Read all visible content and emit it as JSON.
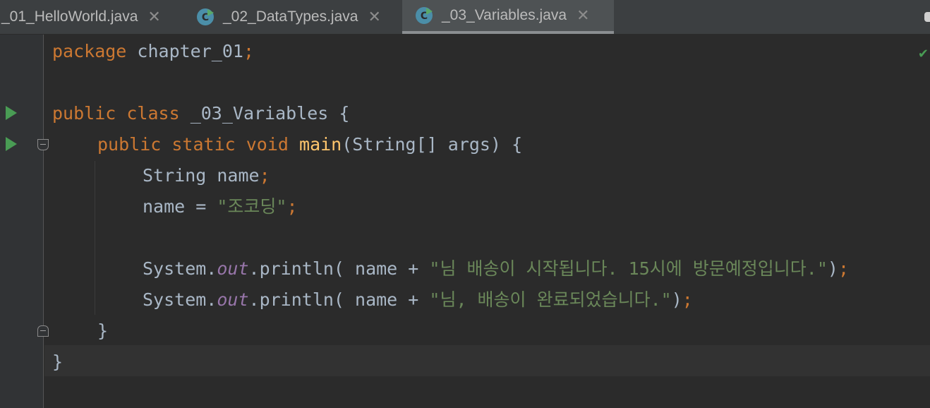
{
  "tabs": [
    {
      "label": "_01_HelloWorld.java",
      "close": "✕",
      "icon": "java-class-icon"
    },
    {
      "label": "_02_DataTypes.java",
      "close": "✕",
      "icon": "java-class-icon"
    },
    {
      "label": "_03_Variables.java",
      "close": "✕",
      "icon": "java-class-icon",
      "active": true
    }
  ],
  "colors": {
    "keyword": "#cc7832",
    "string": "#6a8759",
    "function": "#ffc66d",
    "field": "#9876aa",
    "text": "#a9b7c6",
    "background": "#2b2b2b"
  },
  "code": {
    "l1": {
      "kw": "package",
      "rest": " chapter_01",
      "semi": ";"
    },
    "l3": {
      "kw1": "public",
      "kw2": "class",
      "rest": " _03_Variables {"
    },
    "l4": {
      "kw1": "public",
      "kw2": "static",
      "kw3": "void",
      "fn": "main",
      "rest": "(String[] args) {"
    },
    "l5": {
      "text": "String name",
      "semi": ";"
    },
    "l6": {
      "text": "name = ",
      "str": "\"조코딩\"",
      "semi": ";"
    },
    "l8": {
      "obj": "System.",
      "field": "out",
      "call": ".println( name + ",
      "str": "\"님 배송이 시작됩니다. 15시에 방문예정입니다.\"",
      "close": ")",
      "semi": ";"
    },
    "l9": {
      "obj": "System.",
      "field": "out",
      "call": ".println( name + ",
      "str": "\"님, 배송이 완료되었습니다.\"",
      "close": ")",
      "semi": ";"
    },
    "l10": {
      "text": "}"
    },
    "l11": {
      "text": "}"
    }
  }
}
